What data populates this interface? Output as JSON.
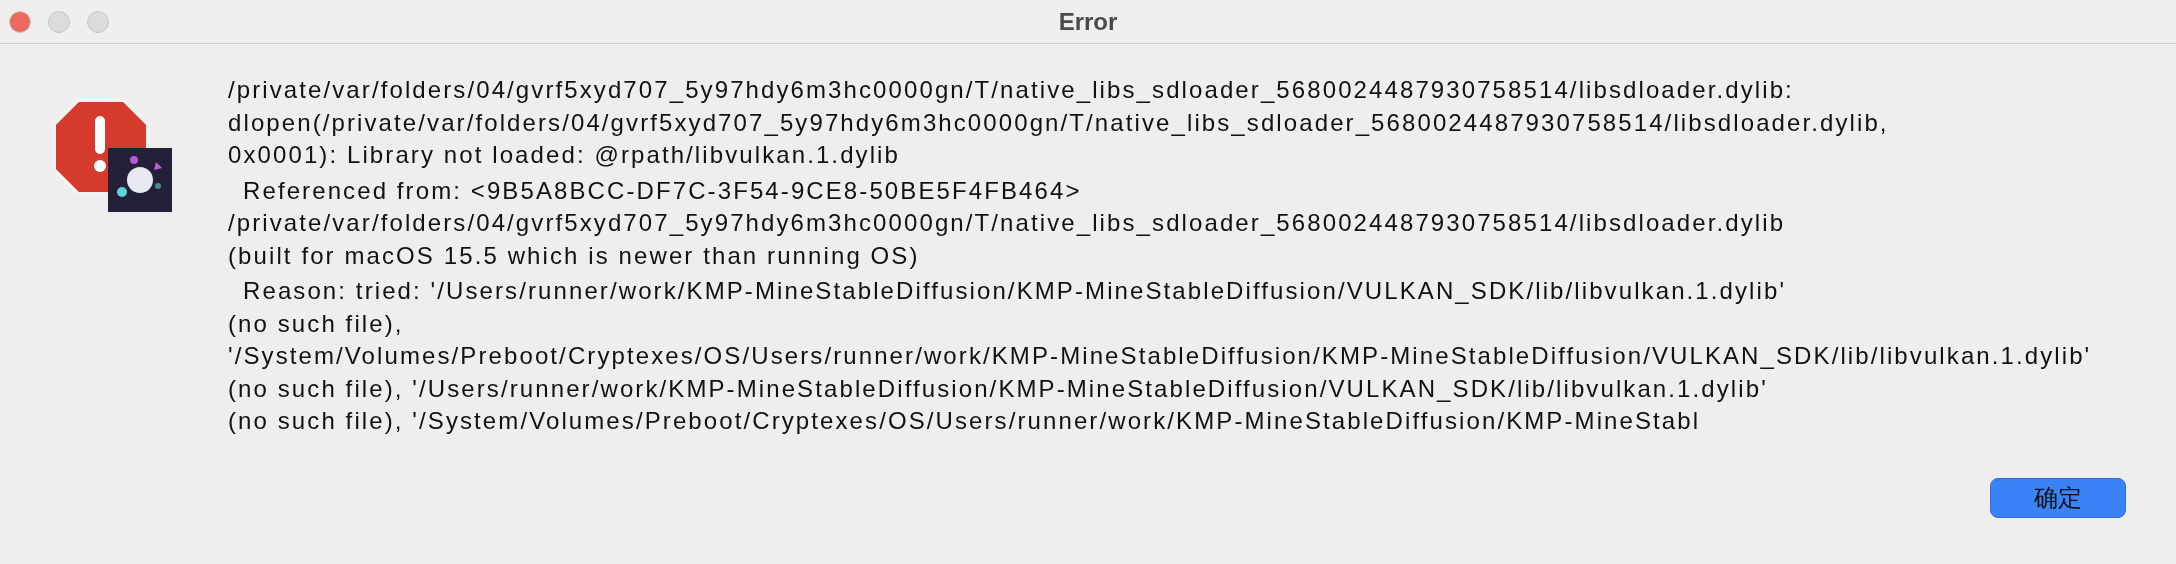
{
  "window": {
    "title": "Error"
  },
  "message": {
    "lines": [
      {
        "text": "/private/var/folders/04/gvrf5xyd707_5y97hdy6m3hc0000gn/T/native_libs_sdloader_5680024487930758514/libsdloader.dylib:",
        "indented": false
      },
      {
        "text": "dlopen(/private/var/folders/04/gvrf5xyd707_5y97hdy6m3hc0000gn/T/native_libs_sdloader_5680024487930758514/libsdloader.dylib,",
        "indented": false
      },
      {
        "text": "0x0001): Library not loaded: @rpath/libvulkan.1.dylib",
        "indented": false
      },
      {
        "text": "Referenced from: <9B5A8BCC-DF7C-3F54-9CE8-50BE5F4FB464>",
        "indented": true
      },
      {
        "text": "/private/var/folders/04/gvrf5xyd707_5y97hdy6m3hc0000gn/T/native_libs_sdloader_5680024487930758514/libsdloader.dylib",
        "indented": false
      },
      {
        "text": "(built for macOS 15.5 which is newer than running OS)",
        "indented": false
      },
      {
        "text": "Reason: tried: '/Users/runner/work/KMP-MineStableDiffusion/KMP-MineStableDiffusion/VULKAN_SDK/lib/libvulkan.1.dylib'",
        "indented": true
      },
      {
        "text": "(no such file),",
        "indented": false
      },
      {
        "text": "'/System/Volumes/Preboot/Cryptexes/OS/Users/runner/work/KMP-MineStableDiffusion/KMP-MineStableDiffusion/VULKAN_SDK/lib/libvulkan.1.dylib'",
        "indented": false
      },
      {
        "text": "(no such file), '/Users/runner/work/KMP-MineStableDiffusion/KMP-MineStableDiffusion/VULKAN_SDK/lib/libvulkan.1.dylib'",
        "indented": false
      },
      {
        "text": "(no such file), '/System/Volumes/Preboot/Cryptexes/OS/Users/runner/work/KMP-MineStableDiffusion/KMP-MineStabl",
        "indented": false
      }
    ]
  },
  "buttons": [
    {
      "label": "确定",
      "default": true
    }
  ]
}
